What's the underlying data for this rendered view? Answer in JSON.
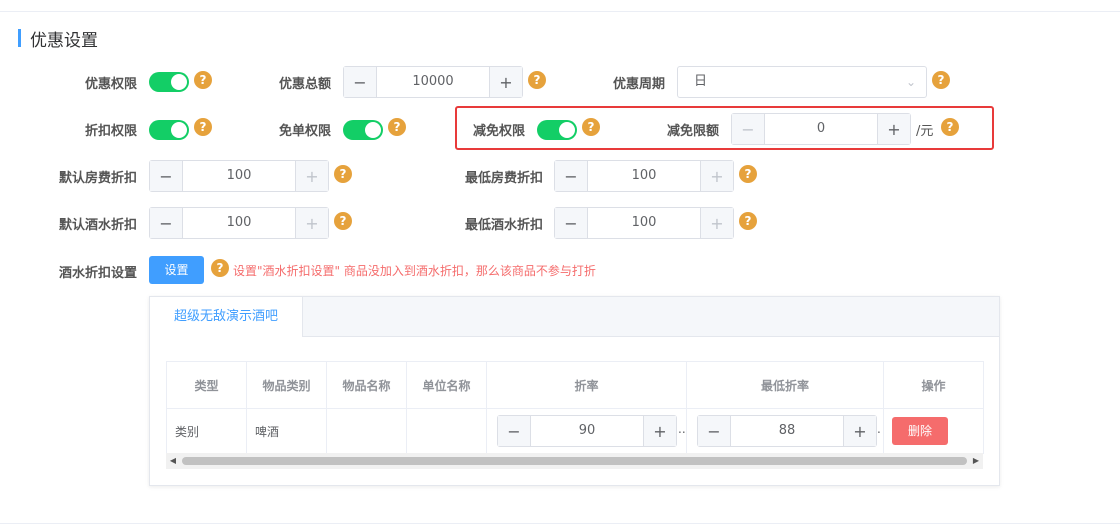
{
  "section": {
    "title": "优惠设置"
  },
  "row1": {
    "permission_label": "优惠权限",
    "total_label": "优惠总额",
    "total_value": "10000",
    "period_label": "优惠周期",
    "period_value": "日"
  },
  "row2": {
    "discount_label": "折扣权限",
    "free_label": "免单权限",
    "reduce_label": "减免权限",
    "reduce_limit_label": "减免限额",
    "reduce_limit_value": "0",
    "reduce_unit": "/元"
  },
  "row3": {
    "room_discount_label": "默认房费折扣",
    "room_discount_value": "100",
    "min_room_discount_label": "最低房费折扣",
    "min_room_discount_value": "100"
  },
  "row4": {
    "drink_discount_label": "默认酒水折扣",
    "drink_discount_value": "100",
    "min_drink_discount_label": "最低酒水折扣",
    "min_drink_discount_value": "100"
  },
  "row5": {
    "drink_setting_label": "酒水折扣设置",
    "set_button": "设置",
    "warning": "设置\"酒水折扣设置\" 商品没加入到酒水折扣，那么该商品不参与打折"
  },
  "tabs": [
    {
      "label": "超级无敌演示酒吧"
    }
  ],
  "table": {
    "headers": [
      "类型",
      "物品类别",
      "物品名称",
      "单位名称",
      "折率",
      "最低折率",
      "操作"
    ],
    "rows": [
      {
        "type": "类别",
        "category": "啤酒",
        "name": "",
        "unit": "",
        "rate": "90",
        "min_rate": "88",
        "action": "删除"
      }
    ]
  },
  "icons": {
    "help": "question-circle-icon",
    "minus": "minus-icon",
    "plus": "plus-icon",
    "chevron": "chevron-down-icon"
  },
  "colors": {
    "primary": "#409eff",
    "success": "#13ce66",
    "warning": "#e6a23c",
    "danger": "#f56c6c",
    "highlight": "#e83a3a"
  }
}
